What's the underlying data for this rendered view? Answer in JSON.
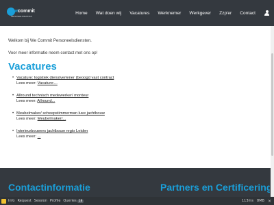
{
  "colors": {
    "header_bg": "#34393f",
    "accent": "#1a9fd9",
    "text": "#222222"
  },
  "logo": {
    "we": "we",
    "commit": "commit",
    "tagline": "PERSONEELSDIENSTEN"
  },
  "nav": {
    "items": [
      "Home",
      "Wat doen wij",
      "Vacatures",
      "Werknemer",
      "Werkgever",
      "Zzp'er",
      "Contact"
    ],
    "user_icon": "user-icon"
  },
  "intro": {
    "welcome": "Welkom bij We Commit Personeelsdiensten.",
    "contact": "Voor meer informatie neem contact met ons op!"
  },
  "vacatures": {
    "title": "Vacatures",
    "items": [
      {
        "title": "Vacature: logistiek dienstverlener (beoogd vast contract",
        "more_prefix": "Lees meer: ",
        "more_link": "Vacature:..."
      },
      {
        "title": "Allround technisch medewerker/ monteur",
        "more_prefix": "Lees meer: ",
        "more_link": "Allround..."
      },
      {
        "title": "Meubelmaker/ scheepstimmerman luxe jachtbouw",
        "more_prefix": "Lees meer: ",
        "more_link": "Meubelmaker/..."
      },
      {
        "title": "Interieurbouwers jachtbouw regio Leiden",
        "more_prefix": "Lees meer: ",
        "more_link": "..."
      }
    ]
  },
  "footer": {
    "contact_title": "Contactinformatie",
    "partners_title": "Partners en Certificering"
  },
  "debugbar": {
    "items": [
      "Info",
      "Request",
      "Session",
      "Profile",
      "Queries"
    ],
    "queries_count": "18",
    "time": "113ms",
    "memory": "8MB"
  }
}
